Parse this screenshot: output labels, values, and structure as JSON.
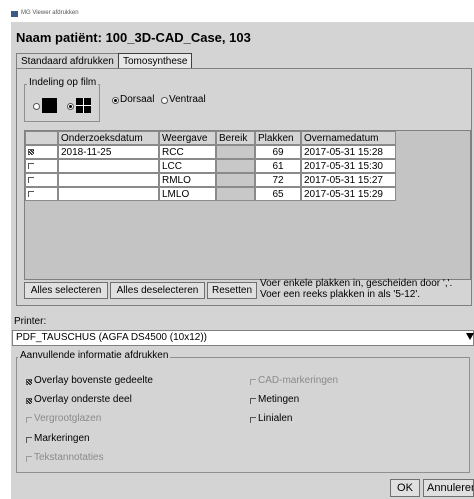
{
  "window": {
    "title": "MG Viewer afdrukken"
  },
  "heading": "Naam patiënt: 100_3D-CAD_Case, 103",
  "tabs": [
    {
      "label": "Standaard afdrukken"
    },
    {
      "label": "Tomosynthese"
    }
  ],
  "film_layout": {
    "legend": "Indeling op film",
    "options": [
      {
        "name": "single",
        "selected": false
      },
      {
        "name": "four",
        "selected": true
      }
    ],
    "orientation": [
      {
        "label": "Dorsaal",
        "selected": true
      },
      {
        "label": "Ventraal",
        "selected": false
      }
    ]
  },
  "table": {
    "headers": [
      "",
      "Onderzoeksdatum",
      "Weergave",
      "Bereik",
      "Plakken",
      "Overnamedatum"
    ],
    "rows": [
      {
        "checked": true,
        "date": "2018-11-25",
        "view": "RCC",
        "range": "",
        "slices": "69",
        "acq": "2017-05-31 15:28"
      },
      {
        "checked": false,
        "date": "",
        "view": "LCC",
        "range": "",
        "slices": "61",
        "acq": "2017-05-31 15:30"
      },
      {
        "checked": false,
        "date": "",
        "view": "RMLO",
        "range": "",
        "slices": "72",
        "acq": "2017-05-31 15:27"
      },
      {
        "checked": false,
        "date": "",
        "view": "LMLO",
        "range": "",
        "slices": "65",
        "acq": "2017-05-31 15:29"
      }
    ]
  },
  "buttons": {
    "select_all": "Alles selecteren",
    "deselect_all": "Alles deselecteren",
    "reset": "Resetten",
    "ok": "OK",
    "cancel": "Annuleren"
  },
  "hint": {
    "line1": "Voer enkele plakken in, gescheiden door ','.",
    "line2": "Voer een reeks plakken in als '5-12'."
  },
  "printer": {
    "label": "Printer:",
    "value": "PDF_TAUSCHUS (AGFA DS4500 (10x12))"
  },
  "extra_info": {
    "legend": "Aanvullende informatie afdrukken",
    "items": [
      {
        "label": "Overlay bovenste gedeelte",
        "checked": true,
        "enabled": true
      },
      {
        "label": "CAD-markeringen",
        "checked": false,
        "enabled": false
      },
      {
        "label": "Overlay onderste deel",
        "checked": true,
        "enabled": true
      },
      {
        "label": "Metingen",
        "checked": false,
        "enabled": true
      },
      {
        "label": "Vergrootglazen",
        "checked": false,
        "enabled": false
      },
      {
        "label": "Linialen",
        "checked": false,
        "enabled": true
      },
      {
        "label": "Markeringen",
        "checked": false,
        "enabled": true
      },
      {
        "label": "Tekstannotaties",
        "checked": false,
        "enabled": false
      }
    ]
  }
}
